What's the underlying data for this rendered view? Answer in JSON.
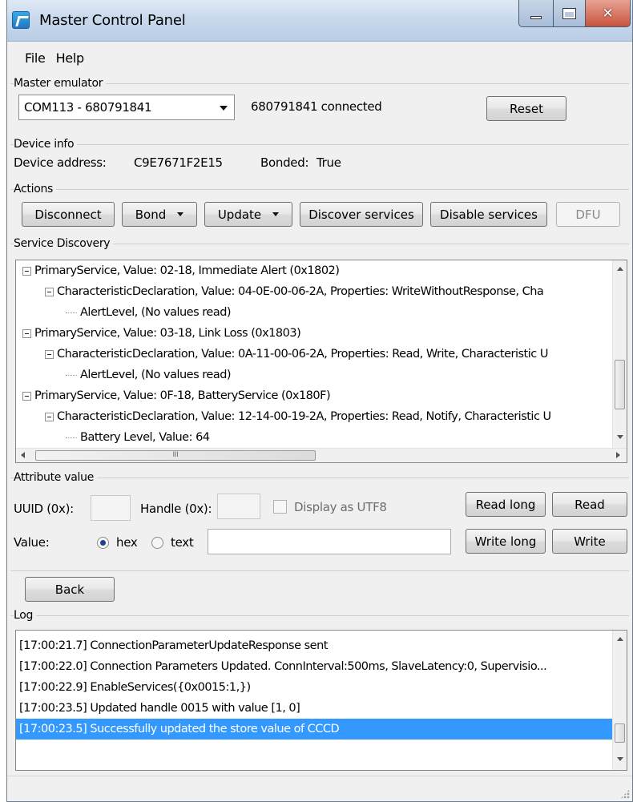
{
  "window": {
    "title": "Master Control Panel"
  },
  "menu": {
    "file": "File",
    "help": "Help"
  },
  "master_emulator": {
    "label": "Master emulator",
    "selected_port": "COM113 - 680791841",
    "status": "680791841 connected",
    "reset": "Reset"
  },
  "device_info": {
    "label": "Device info",
    "address_label": "Device address:",
    "address": "C9E7671F2E15",
    "bonded_label": "Bonded:",
    "bonded": "True"
  },
  "actions": {
    "label": "Actions",
    "disconnect": "Disconnect",
    "bond": "Bond",
    "update": "Update",
    "discover": "Discover services",
    "disable": "Disable services",
    "dfu": "DFU"
  },
  "service_discovery": {
    "label": "Service Discovery",
    "rows": [
      "PrimaryService, Value: 02-18, Immediate Alert (0x1802)",
      "CharacteristicDeclaration, Value: 04-0E-00-06-2A, Properties: WriteWithoutResponse, Cha",
      "AlertLevel, (No values read)",
      "PrimaryService, Value: 03-18, Link Loss (0x1803)",
      "CharacteristicDeclaration, Value: 0A-11-00-06-2A, Properties: Read, Write, Characteristic U",
      "AlertLevel, (No values read)",
      "PrimaryService, Value: 0F-18, BatteryService (0x180F)",
      "CharacteristicDeclaration, Value: 12-14-00-19-2A, Properties: Read, Notify, Characteristic U",
      "Battery Level, Value: 64"
    ]
  },
  "attribute_value": {
    "label": "Attribute value",
    "uuid_label": "UUID (0x):",
    "handle_label": "Handle (0x):",
    "display_utf8": "Display as UTF8",
    "read_long": "Read long",
    "read": "Read",
    "value_label": "Value:",
    "hex": "hex",
    "text": "text",
    "write_long": "Write long",
    "write": "Write"
  },
  "nav": {
    "back": "Back"
  },
  "log": {
    "label": "Log",
    "rows": [
      "[17:00:21.7] ConnectionParameterUpdateResponse sent",
      "[17:00:22.0] Connection Parameters Updated. ConnInterval:500ms, SlaveLatency:0, Supervisio...",
      "[17:00:22.9] EnableServices({0x0015:1,})",
      "[17:00:23.5] Updated handle 0015 with value [1, 0]",
      "[17:00:23.5] Successfully updated the store value of CCCD"
    ]
  },
  "colors": {
    "selection": "#3399ff",
    "titlebar": "#c9d9ec"
  },
  "icons": {
    "hscroll_marker": "III"
  }
}
